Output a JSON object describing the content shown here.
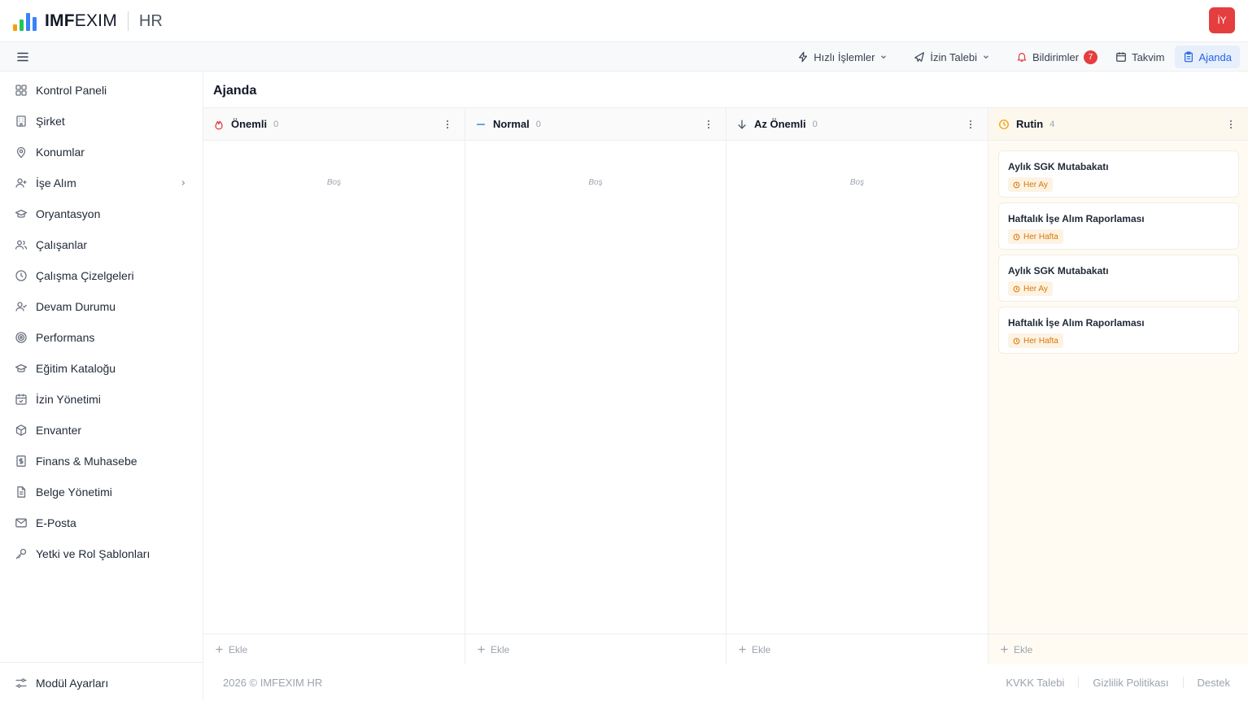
{
  "app": {
    "logo_bold": "IMF",
    "logo_light": "EXIM",
    "module": "HR",
    "user_initials": "İY"
  },
  "toolbar": {
    "quick_actions": "Hızlı İşlemler",
    "leave_request": "İzin Talebi",
    "notifications": "Bildirimler",
    "notifications_count": "7",
    "calendar": "Takvim",
    "agenda": "Ajanda"
  },
  "sidebar": {
    "items": [
      {
        "label": "Kontrol Paneli",
        "icon": "dashboard-icon"
      },
      {
        "label": "Şirket",
        "icon": "building-icon"
      },
      {
        "label": "Konumlar",
        "icon": "map-pin-icon"
      },
      {
        "label": "İşe Alım",
        "icon": "user-plus-icon"
      },
      {
        "label": "Oryantasyon",
        "icon": "graduation-cap-icon"
      },
      {
        "label": "Çalışanlar",
        "icon": "users-icon"
      },
      {
        "label": "Çalışma Çizelgeleri",
        "icon": "clock-icon"
      },
      {
        "label": "Devam Durumu",
        "icon": "user-check-icon"
      },
      {
        "label": "Performans",
        "icon": "target-icon"
      },
      {
        "label": "Eğitim Kataloğu",
        "icon": "graduation-cap-icon"
      },
      {
        "label": "İzin Yönetimi",
        "icon": "calendar-check-icon"
      },
      {
        "label": "Envanter",
        "icon": "box-icon"
      },
      {
        "label": "Finans & Muhasebe",
        "icon": "receipt-icon"
      },
      {
        "label": "Belge Yönetimi",
        "icon": "file-icon"
      },
      {
        "label": "E-Posta",
        "icon": "mail-icon"
      },
      {
        "label": "Yetki ve Rol Şablonları",
        "icon": "key-icon"
      }
    ],
    "footer": "Modül Ayarları"
  },
  "page": {
    "title": "Ajanda"
  },
  "board": {
    "add_label": "Ekle",
    "empty_label": "Boş",
    "columns": [
      {
        "title": "Önemli",
        "count": "0",
        "icon": "flame-icon"
      },
      {
        "title": "Normal",
        "count": "0",
        "icon": "minus-icon"
      },
      {
        "title": "Az Önemli",
        "count": "0",
        "icon": "arrow-down-icon"
      },
      {
        "title": "Rutin",
        "count": "4",
        "icon": "clock-icon"
      }
    ],
    "rutin_cards": [
      {
        "title": "Aylık SGK Mutabakatı",
        "freq": "Her Ay"
      },
      {
        "title": "Haftalık İşe Alım Raporlaması",
        "freq": "Her Hafta"
      },
      {
        "title": "Aylık SGK Mutabakatı",
        "freq": "Her Ay"
      },
      {
        "title": "Haftalık İşe Alım Raporlaması",
        "freq": "Her Hafta"
      }
    ]
  },
  "footer": {
    "copyright": "2026 © IMFEXIM HR",
    "links": [
      "KVKK Talebi",
      "Gizlilik Politikası",
      "Destek"
    ]
  },
  "colors": {
    "accent": "#2563eb",
    "danger": "#e53e3e",
    "rutin_tag": "#d97706",
    "rutin_bg": "#fffbf2"
  }
}
